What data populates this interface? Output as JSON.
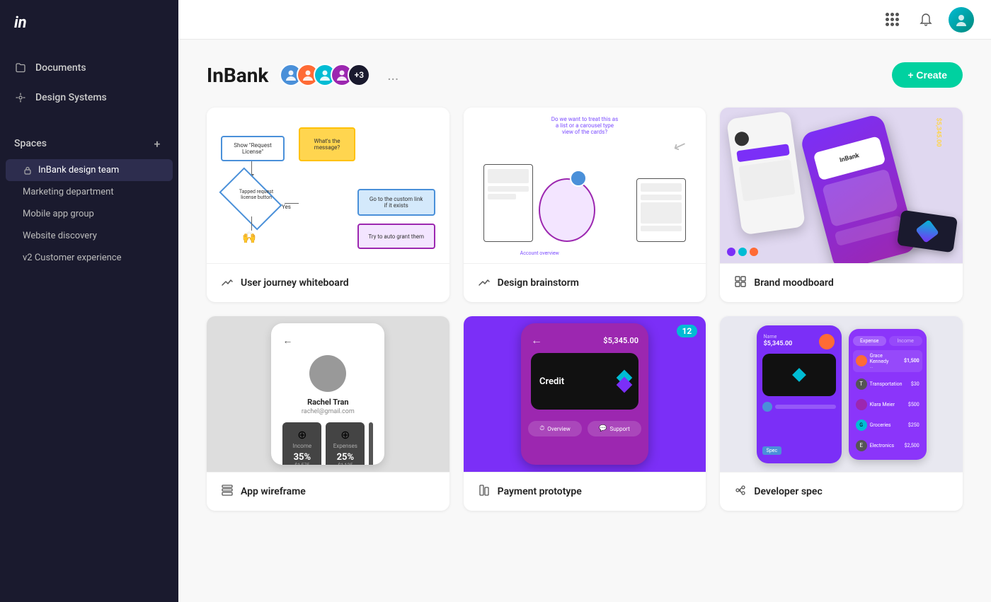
{
  "sidebar": {
    "logo": "in",
    "nav_items": [
      {
        "id": "documents",
        "label": "Documents",
        "icon": "folder"
      },
      {
        "id": "design-systems",
        "label": "Design Systems",
        "icon": "design"
      }
    ],
    "spaces_label": "Spaces",
    "spaces_add": "+",
    "spaces": [
      {
        "id": "inbank",
        "label": "InBank design team",
        "active": true
      },
      {
        "id": "marketing",
        "label": "Marketing department",
        "active": false
      },
      {
        "id": "mobile",
        "label": "Mobile app group",
        "active": false
      },
      {
        "id": "website",
        "label": "Website discovery",
        "active": false
      },
      {
        "id": "v2",
        "label": "v2 Customer experience",
        "active": false
      }
    ]
  },
  "topbar": {
    "grid_icon": "grid",
    "bell_icon": "bell",
    "avatar_color": "#00bcd4"
  },
  "project": {
    "title": "InBank",
    "member_count": "+3",
    "more_icon": "...",
    "create_label": "+ Create"
  },
  "cards": [
    {
      "id": "user-journey",
      "label": "User journey whiteboard",
      "icon": "whiteboard",
      "type": "whiteboard"
    },
    {
      "id": "design-brainstorm",
      "label": "Design brainstorm",
      "icon": "whiteboard",
      "type": "brainstorm"
    },
    {
      "id": "brand-moodboard",
      "label": "Brand moodboard",
      "icon": "grid",
      "type": "moodboard"
    },
    {
      "id": "app-wireframe",
      "label": "App wireframe",
      "icon": "wireframe",
      "type": "wireframe"
    },
    {
      "id": "payment-prototype",
      "label": "Payment prototype",
      "icon": "prototype",
      "type": "prototype",
      "badge": "12"
    },
    {
      "id": "developer-spec",
      "label": "Developer spec",
      "icon": "spec",
      "type": "spec"
    }
  ]
}
